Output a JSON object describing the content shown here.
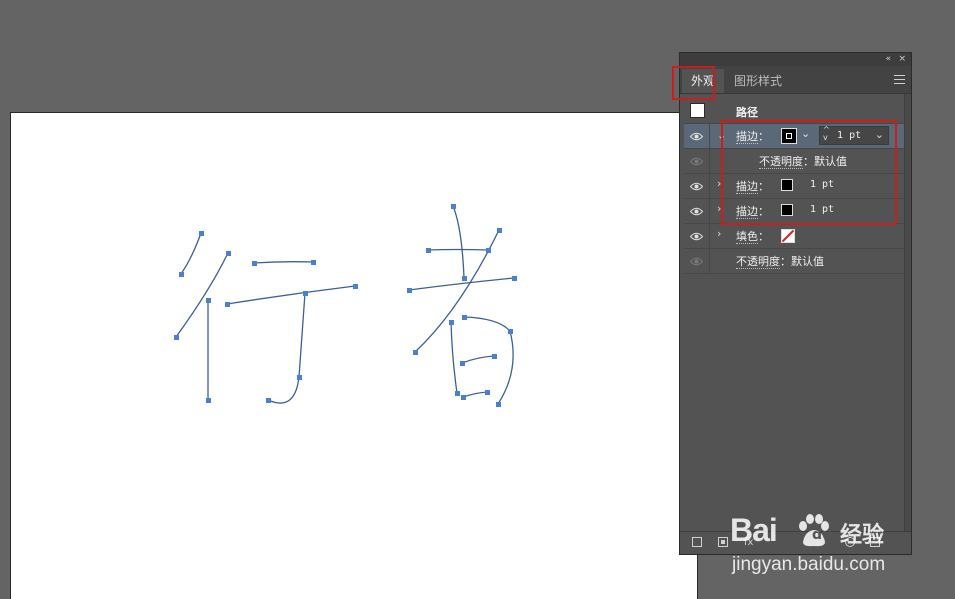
{
  "panel": {
    "tabs": [
      {
        "label": "外观",
        "active": true
      },
      {
        "label": "图形样式",
        "active": false
      }
    ],
    "top_icons": {
      "collapse": "«",
      "close": "×"
    },
    "header": {
      "label": "路径"
    },
    "rows": [
      {
        "label": "描边",
        "suffix": "：",
        "weight_value": "1",
        "weight_unit": "pt",
        "selected": true,
        "expanded": true
      },
      {
        "label": "不透明度",
        "suffix": "：",
        "value": "默认值"
      },
      {
        "label": "描边",
        "suffix": "：",
        "weight": "1 pt"
      },
      {
        "label": "描边",
        "suffix": "：",
        "weight": "1 pt"
      },
      {
        "label": "填色",
        "suffix": "："
      },
      {
        "label": "不透明度",
        "suffix": "：",
        "value": "默认值"
      }
    ]
  },
  "colors": {
    "path_stroke": "#3b5f9e",
    "anchor": "#4a7fd6",
    "highlight": "#c81e1e",
    "canvas": "#646464"
  },
  "watermark": {
    "logo_left": "Bai",
    "logo_right": "du",
    "service": "经验",
    "url": "jingyan.baidu.com"
  }
}
